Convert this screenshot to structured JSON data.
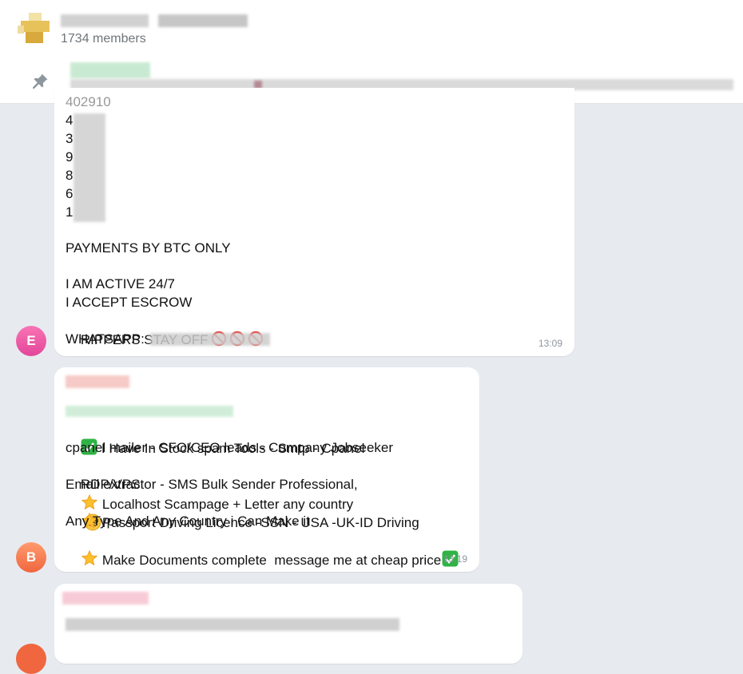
{
  "header": {
    "members": "1734 members"
  },
  "messages": [
    {
      "sender_initial": "E",
      "avatar_color": "#ec4e9f",
      "lines": {
        "l1": "4",
        "l2": "3",
        "l3": "9",
        "l4": "8",
        "l5": "6",
        "l6": "1",
        "l7": "PAYMENTS BY BTC ONLY",
        "l8": "I AM ACTIVE 24/7",
        "l9": "I ACCEPT ESCROW",
        "l10": "RIPPERS STAY OFF",
        "l11": "WHATSAPP:"
      },
      "time": "13:09"
    },
    {
      "sender_initial": "B",
      "avatar_color": "#f47d57",
      "lines": {
        "l1": "I Have In Stock spam Tools - Smtp - Cpanel",
        "l2": "cpanel mailer - CFO/CEO leads - Company Jobseeker",
        "l3": "RDP/VPS",
        "l3b": "Localhost Scampage + Letter any country",
        "l4": "Email extractor - SMS Bulk Sender Professional,",
        "l5": "Passport Driving Licence -SSN - USA -UK-ID Driving",
        "l6": "Any Type And Any Country i Can Make it",
        "l7": "Make Documents complete  message me at cheap price"
      },
      "time": "13:19"
    },
    {
      "sender_initial": "",
      "avatar_color": "#f47d57"
    }
  ],
  "icons": {
    "pin": "pin-icon",
    "no_entry": "no-entry-icon",
    "check": "check-mark-icon",
    "star": "star-icon",
    "monocle": "face-with-monocle-icon"
  }
}
